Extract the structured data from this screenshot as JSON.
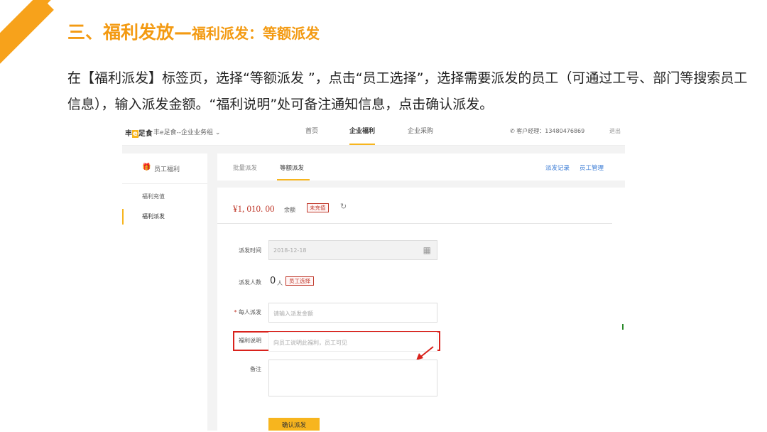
{
  "slide": {
    "title_main": "三、福利发放—",
    "title_sub": "福利派发：等额派发",
    "description": "在【福利派发】标签页，选择“等额派发 ”，点击“员工选择”，选择需要派发的员工（可通过工号、部门等搜索员工信息），输入派发金额。“福利说明”处可备注通知信息，点击确认派发。",
    "accent_color": "#f39a12"
  },
  "app": {
    "logo_prefix": "丰",
    "logo_hl": "e",
    "logo_suffix": "足食",
    "company": "丰e足食--企业业务组",
    "company_chevron": "⌄",
    "nav": [
      {
        "label": "首页"
      },
      {
        "label": "企业福利"
      },
      {
        "label": "企业采购"
      }
    ],
    "contact": "客户经理：13480476869",
    "logout": "退出"
  },
  "sidebar": {
    "header": "员工福利",
    "items": [
      {
        "label": "福利充值"
      },
      {
        "label": "福利派发"
      }
    ]
  },
  "tabs": {
    "items": [
      {
        "label": "批量派发"
      },
      {
        "label": "等额派发"
      }
    ],
    "links": [
      {
        "label": "派发记录"
      },
      {
        "label": "员工管理"
      }
    ]
  },
  "balance": {
    "amount": "¥1, 010. 00",
    "label": "余额",
    "status": "未充值"
  },
  "form": {
    "date_label": "派发时间",
    "date_value": "2018-12-18",
    "count_label": "派发人数",
    "count_value": "0",
    "count_unit": "人",
    "select_button": "员工选择",
    "amount_label": "每人派发",
    "amount_required": "*",
    "amount_placeholder": "请输入派发金额",
    "note_label": "福利说明",
    "note_placeholder": "向员工说明此福利，员工可见",
    "remark_label": "备注",
    "submit": "确认派发"
  }
}
